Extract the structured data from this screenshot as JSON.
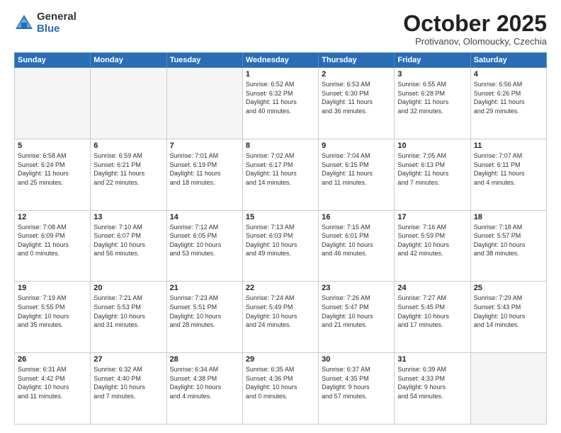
{
  "header": {
    "logo_general": "General",
    "logo_blue": "Blue",
    "month_title": "October 2025",
    "location": "Protivanov, Olomoucky, Czechia"
  },
  "weekdays": [
    "Sunday",
    "Monday",
    "Tuesday",
    "Wednesday",
    "Thursday",
    "Friday",
    "Saturday"
  ],
  "weeks": [
    [
      {
        "day": "",
        "info": ""
      },
      {
        "day": "",
        "info": ""
      },
      {
        "day": "",
        "info": ""
      },
      {
        "day": "1",
        "info": "Sunrise: 6:52 AM\nSunset: 6:32 PM\nDaylight: 11 hours\nand 40 minutes."
      },
      {
        "day": "2",
        "info": "Sunrise: 6:53 AM\nSunset: 6:30 PM\nDaylight: 11 hours\nand 36 minutes."
      },
      {
        "day": "3",
        "info": "Sunrise: 6:55 AM\nSunset: 6:28 PM\nDaylight: 11 hours\nand 32 minutes."
      },
      {
        "day": "4",
        "info": "Sunrise: 6:56 AM\nSunset: 6:26 PM\nDaylight: 11 hours\nand 29 minutes."
      }
    ],
    [
      {
        "day": "5",
        "info": "Sunrise: 6:58 AM\nSunset: 6:24 PM\nDaylight: 11 hours\nand 25 minutes."
      },
      {
        "day": "6",
        "info": "Sunrise: 6:59 AM\nSunset: 6:21 PM\nDaylight: 11 hours\nand 22 minutes."
      },
      {
        "day": "7",
        "info": "Sunrise: 7:01 AM\nSunset: 6:19 PM\nDaylight: 11 hours\nand 18 minutes."
      },
      {
        "day": "8",
        "info": "Sunrise: 7:02 AM\nSunset: 6:17 PM\nDaylight: 11 hours\nand 14 minutes."
      },
      {
        "day": "9",
        "info": "Sunrise: 7:04 AM\nSunset: 6:15 PM\nDaylight: 11 hours\nand 11 minutes."
      },
      {
        "day": "10",
        "info": "Sunrise: 7:05 AM\nSunset: 6:13 PM\nDaylight: 11 hours\nand 7 minutes."
      },
      {
        "day": "11",
        "info": "Sunrise: 7:07 AM\nSunset: 6:11 PM\nDaylight: 11 hours\nand 4 minutes."
      }
    ],
    [
      {
        "day": "12",
        "info": "Sunrise: 7:08 AM\nSunset: 6:09 PM\nDaylight: 11 hours\nand 0 minutes."
      },
      {
        "day": "13",
        "info": "Sunrise: 7:10 AM\nSunset: 6:07 PM\nDaylight: 10 hours\nand 56 minutes."
      },
      {
        "day": "14",
        "info": "Sunrise: 7:12 AM\nSunset: 6:05 PM\nDaylight: 10 hours\nand 53 minutes."
      },
      {
        "day": "15",
        "info": "Sunrise: 7:13 AM\nSunset: 6:03 PM\nDaylight: 10 hours\nand 49 minutes."
      },
      {
        "day": "16",
        "info": "Sunrise: 7:15 AM\nSunset: 6:01 PM\nDaylight: 10 hours\nand 46 minutes."
      },
      {
        "day": "17",
        "info": "Sunrise: 7:16 AM\nSunset: 5:59 PM\nDaylight: 10 hours\nand 42 minutes."
      },
      {
        "day": "18",
        "info": "Sunrise: 7:18 AM\nSunset: 5:57 PM\nDaylight: 10 hours\nand 38 minutes."
      }
    ],
    [
      {
        "day": "19",
        "info": "Sunrise: 7:19 AM\nSunset: 5:55 PM\nDaylight: 10 hours\nand 35 minutes."
      },
      {
        "day": "20",
        "info": "Sunrise: 7:21 AM\nSunset: 5:53 PM\nDaylight: 10 hours\nand 31 minutes."
      },
      {
        "day": "21",
        "info": "Sunrise: 7:23 AM\nSunset: 5:51 PM\nDaylight: 10 hours\nand 28 minutes."
      },
      {
        "day": "22",
        "info": "Sunrise: 7:24 AM\nSunset: 5:49 PM\nDaylight: 10 hours\nand 24 minutes."
      },
      {
        "day": "23",
        "info": "Sunrise: 7:26 AM\nSunset: 5:47 PM\nDaylight: 10 hours\nand 21 minutes."
      },
      {
        "day": "24",
        "info": "Sunrise: 7:27 AM\nSunset: 5:45 PM\nDaylight: 10 hours\nand 17 minutes."
      },
      {
        "day": "25",
        "info": "Sunrise: 7:29 AM\nSunset: 5:43 PM\nDaylight: 10 hours\nand 14 minutes."
      }
    ],
    [
      {
        "day": "26",
        "info": "Sunrise: 6:31 AM\nSunset: 4:42 PM\nDaylight: 10 hours\nand 11 minutes."
      },
      {
        "day": "27",
        "info": "Sunrise: 6:32 AM\nSunset: 4:40 PM\nDaylight: 10 hours\nand 7 minutes."
      },
      {
        "day": "28",
        "info": "Sunrise: 6:34 AM\nSunset: 4:38 PM\nDaylight: 10 hours\nand 4 minutes."
      },
      {
        "day": "29",
        "info": "Sunrise: 6:35 AM\nSunset: 4:36 PM\nDaylight: 10 hours\nand 0 minutes."
      },
      {
        "day": "30",
        "info": "Sunrise: 6:37 AM\nSunset: 4:35 PM\nDaylight: 9 hours\nand 57 minutes."
      },
      {
        "day": "31",
        "info": "Sunrise: 6:39 AM\nSunset: 4:33 PM\nDaylight: 9 hours\nand 54 minutes."
      },
      {
        "day": "",
        "info": ""
      }
    ]
  ]
}
